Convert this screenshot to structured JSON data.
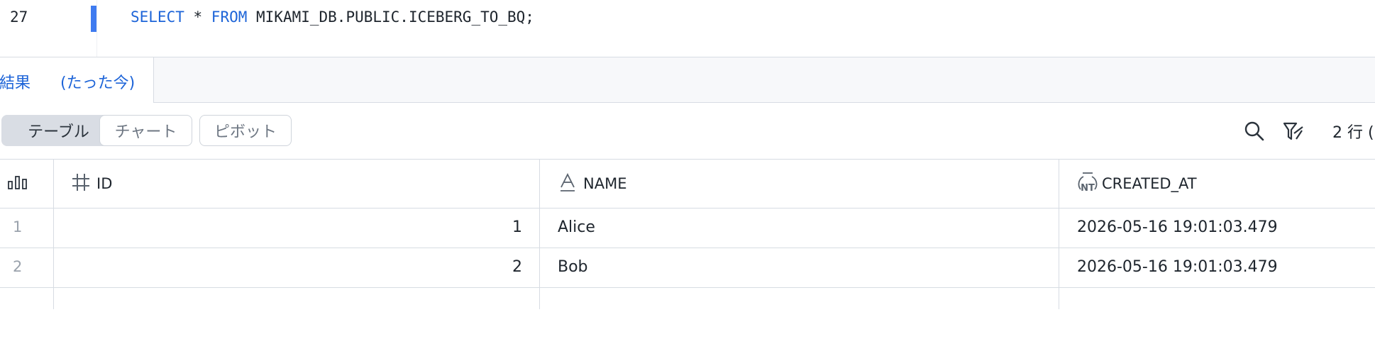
{
  "editor": {
    "line_number": "27",
    "code": {
      "kw_select": "SELECT",
      "star": " * ",
      "kw_from": "FROM",
      "rest": " MIKAMI_DB.PUBLIC.ICEBERG_TO_BQ;"
    }
  },
  "results": {
    "title": "結果",
    "time": "(たった今)"
  },
  "toolbar": {
    "views": [
      "テーブル",
      "チャート",
      "ピボット"
    ],
    "active_view": "テーブル",
    "row_count": "2 行 ("
  },
  "table": {
    "columns": [
      {
        "name": "ID",
        "type_icon": "hash-icon"
      },
      {
        "name": "NAME",
        "type_icon": "text-type-icon"
      },
      {
        "name": "CREATED_AT",
        "type_icon": "timestamp-ntz-icon"
      }
    ],
    "rows": [
      {
        "index": "1",
        "id": "1",
        "name": "Alice",
        "created_at": "2026-05-16 19:01:03.479"
      },
      {
        "index": "2",
        "id": "2",
        "name": "Bob",
        "created_at": "2026-05-16 19:01:03.479"
      }
    ]
  },
  "colors": {
    "accent": "#1d64d8",
    "active_line_marker": "#3f7bf0",
    "grid": "#d7dce3"
  }
}
